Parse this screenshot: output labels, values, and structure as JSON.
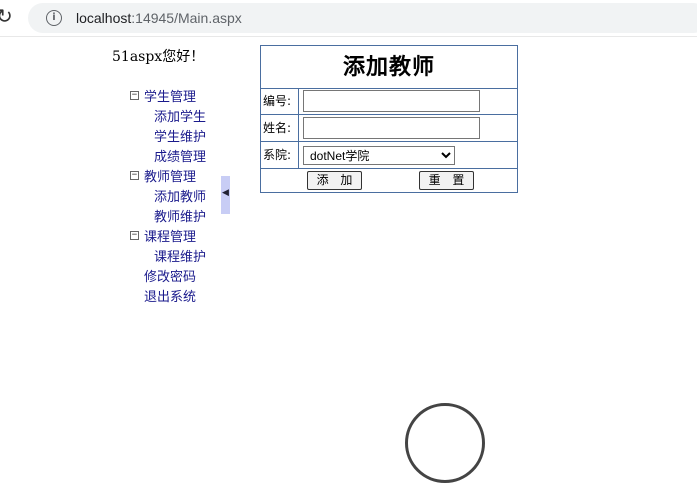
{
  "browser": {
    "url_host": "localhost",
    "url_rest": ":14945/Main.aspx"
  },
  "sidebar": {
    "welcome": "51aspx您好！",
    "groups": [
      {
        "label": "学生管理",
        "items": [
          "添加学生",
          "学生维护",
          "成绩管理"
        ]
      },
      {
        "label": "教师管理",
        "items": [
          "添加教师",
          "教师维护"
        ]
      },
      {
        "label": "课程管理",
        "items": [
          "课程维护"
        ]
      }
    ],
    "links": [
      "修改密码",
      "退出系统"
    ],
    "toggle_symbol": "⊟"
  },
  "form": {
    "title": "添加教师",
    "fields": {
      "id_label": "编号:",
      "name_label": "姓名:",
      "dept_label": "系院:",
      "dept_selected": "dotNet学院"
    },
    "add_button": "添 加",
    "reset_button": "重 置"
  }
}
